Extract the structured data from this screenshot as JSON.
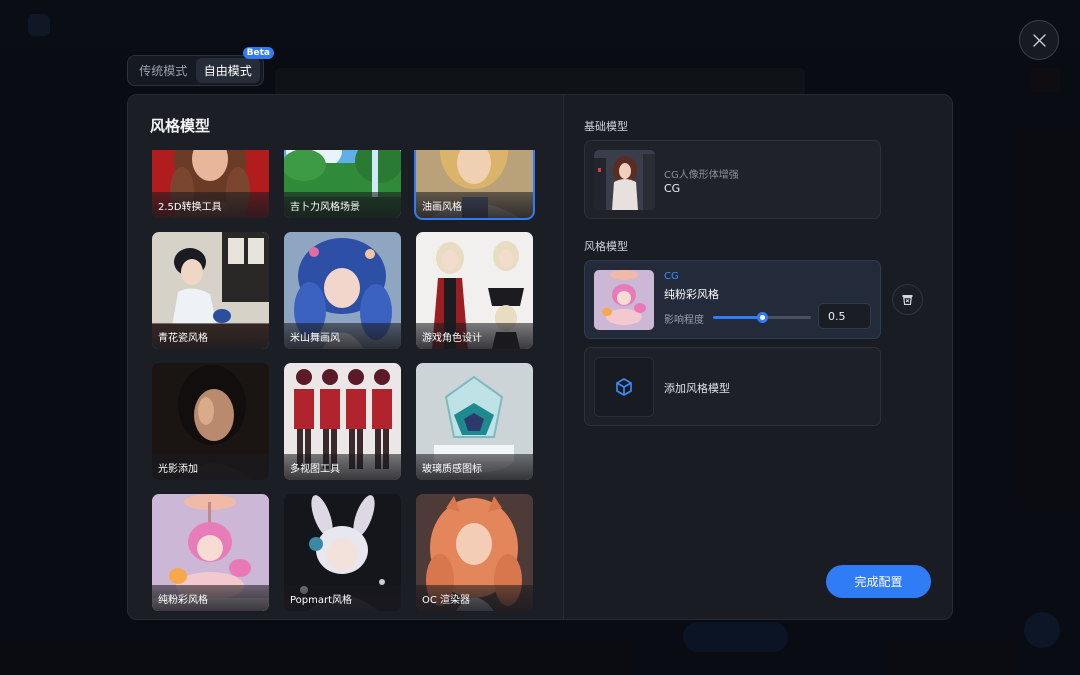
{
  "mode_toggle": {
    "tabs": [
      {
        "label": "传统模式",
        "active": false
      },
      {
        "label": "自由模式",
        "active": true
      }
    ],
    "badge": "Beta"
  },
  "left_panel": {
    "title": "风格模型",
    "cards": [
      {
        "label": "2.5D转换工具",
        "thumb": "woman-portrait-red",
        "selected": false
      },
      {
        "label": "吉卜力风格场景",
        "thumb": "ghibli-landscape",
        "selected": false
      },
      {
        "label": "油画风格",
        "thumb": "oil-painting-portrait",
        "selected": true
      },
      {
        "label": "青花瓷风格",
        "thumb": "porcelain-woman",
        "selected": false
      },
      {
        "label": "米山舞画风",
        "thumb": "anime-blue-hair",
        "selected": false
      },
      {
        "label": "游戏角色设计",
        "thumb": "game-character-sheet",
        "selected": false
      },
      {
        "label": "光影添加",
        "thumb": "portrait-lighting",
        "selected": false
      },
      {
        "label": "多视图工具",
        "thumb": "multi-view-character",
        "selected": false
      },
      {
        "label": "玻璃质感图标",
        "thumb": "glass-icon",
        "selected": false
      },
      {
        "label": "纯粉彩风格",
        "thumb": "pastel-doll",
        "selected": false
      },
      {
        "label": "Popmart风格",
        "thumb": "popmart-bunny",
        "selected": false
      },
      {
        "label": "OC 渲染器",
        "thumb": "orange-hair-girl",
        "selected": false
      }
    ]
  },
  "right_panel": {
    "base_section_label": "基础模型",
    "base_model": {
      "name": "CG人像形体增强",
      "type": "CG"
    },
    "style_section_label": "风格模型",
    "style_model": {
      "tag": "CG",
      "name": "纯粉彩风格",
      "influence_label": "影响程度",
      "influence_value": "0.5",
      "influence_fraction": 0.5
    },
    "add_label": "添加风格模型",
    "done_label": "完成配置"
  },
  "colors": {
    "accent": "#2f7cf6",
    "modal_bg": "#191c22",
    "overlay": "#0e1116"
  },
  "icons": {
    "close": "close-icon",
    "delete": "trash-icon",
    "add": "cube-icon"
  }
}
